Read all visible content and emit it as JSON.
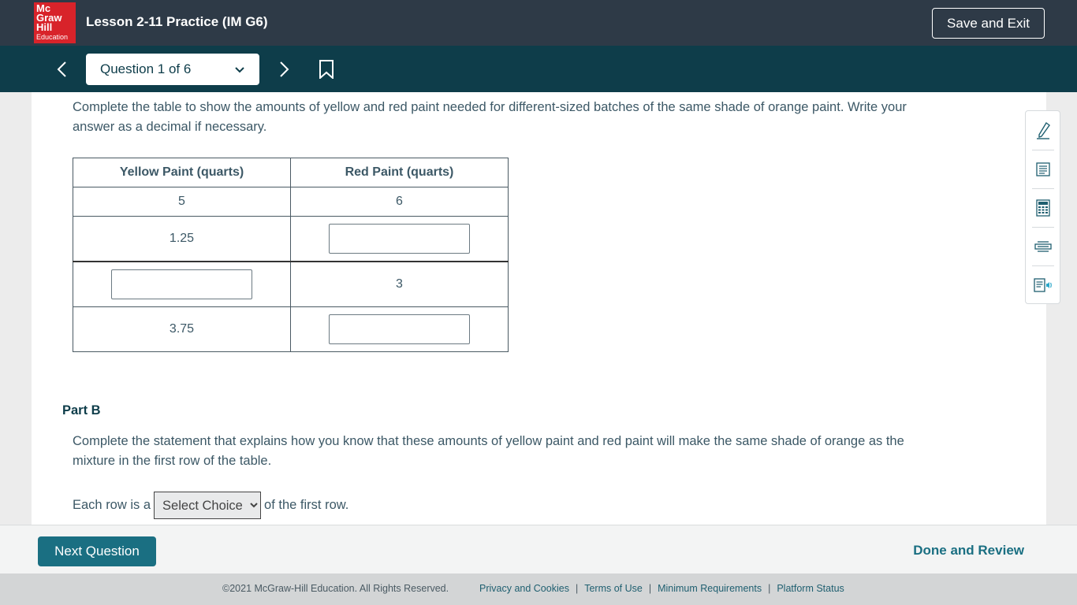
{
  "header": {
    "logo_lines": [
      "Mc",
      "Graw",
      "Hill",
      "Education"
    ],
    "lesson_title": "Lesson 2-11 Practice (IM G6)",
    "save_exit_label": "Save and Exit"
  },
  "nav": {
    "question_label": "Question 1 of 6"
  },
  "part_a": {
    "instructions": "Complete the table to show the amounts of yellow and red paint needed for different-sized batches of the same shade of orange paint. Write your answer as a decimal if necessary.",
    "table": {
      "headers": [
        "Yellow Paint (quarts)",
        "Red Paint (quarts)"
      ],
      "rows": [
        {
          "yellow": "5",
          "red": "6"
        },
        {
          "yellow": "1.25",
          "red": ""
        },
        {
          "yellow": "",
          "red": "3"
        },
        {
          "yellow": "3.75",
          "red": ""
        }
      ]
    }
  },
  "part_b": {
    "heading": "Part B",
    "statement": "Complete the statement that explains how you know that these amounts of yellow paint and red paint will make the same shade of orange as the mixture in the first row of the table.",
    "sentence_before": "Each row is a",
    "select_value": "Select Choice",
    "sentence_after": "of the first row."
  },
  "tools": [
    "pen-icon",
    "notes-icon",
    "calculator-icon",
    "line-reader-icon",
    "text-to-speech-icon"
  ],
  "bottom": {
    "next_label": "Next Question",
    "done_label": "Done and Review"
  },
  "footer": {
    "copyright": "©2021 McGraw-Hill Education. All Rights Reserved.",
    "links": [
      "Privacy and Cookies",
      "Terms of Use",
      "Minimum Requirements",
      "Platform Status"
    ]
  },
  "colors": {
    "topbar": "#2e3a47",
    "navbar": "#0e3d4a",
    "logo_red": "#d8232a",
    "accent": "#1a6f82"
  }
}
